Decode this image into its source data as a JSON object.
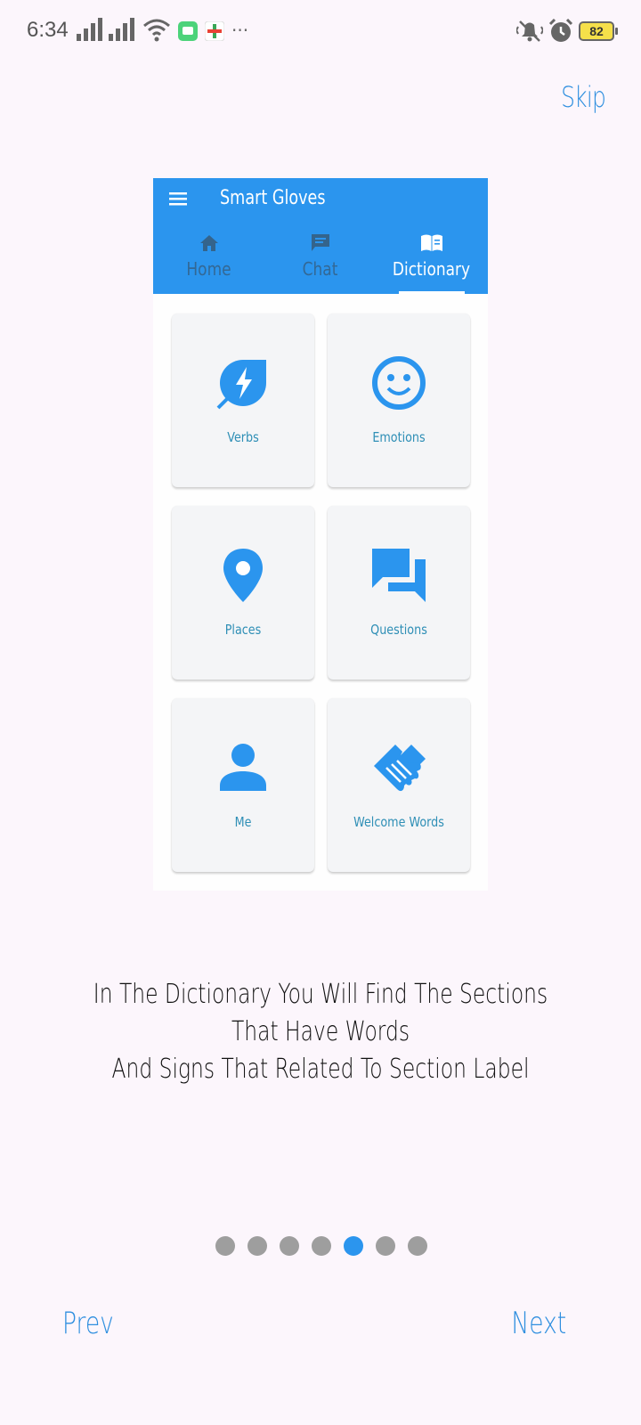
{
  "status_bar": {
    "time": "6:34",
    "battery": "82",
    "more": "···"
  },
  "onboarding": {
    "skip_label": "Skip",
    "description_line1": "In The Dictionary You Will Find The Sections That Have Words",
    "description_line2": "And Signs That Related To Section Label",
    "prev_label": "Prev",
    "next_label": "Next",
    "page_count": 7,
    "active_page_index": 4
  },
  "mockup": {
    "app_title": "Smart Gloves",
    "tabs": [
      {
        "label": "Home",
        "icon": "home-icon",
        "active": false
      },
      {
        "label": "Chat",
        "icon": "chat-icon",
        "active": false
      },
      {
        "label": "Dictionary",
        "icon": "book-icon",
        "active": true
      }
    ],
    "cards": [
      {
        "label": "Verbs",
        "icon": "leaf-bolt-icon"
      },
      {
        "label": "Emotions",
        "icon": "smiley-icon"
      },
      {
        "label": "Places",
        "icon": "location-pin-icon"
      },
      {
        "label": "Questions",
        "icon": "forum-icon"
      },
      {
        "label": "Me",
        "icon": "person-icon"
      },
      {
        "label": "Welcome Words",
        "icon": "handshake-icon"
      }
    ]
  },
  "colors": {
    "accent": "#2b95ee",
    "background": "#fcf6fc",
    "dot_inactive": "#9e9e9e"
  }
}
